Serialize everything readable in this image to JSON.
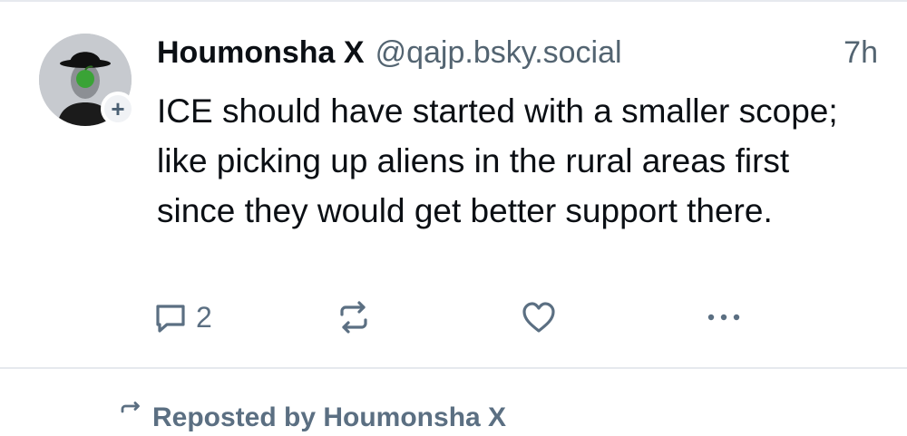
{
  "post": {
    "author": {
      "display_name": "Houmonsha X",
      "handle": "@qajp.bsky.social",
      "avatar_icon": "bowler-hat-man-with-apple-avatar",
      "follow_icon": "plus-icon",
      "follow_label": "+"
    },
    "time": "7h",
    "text": "ICE should have started with a smaller scope; like picking up aliens in the rural areas first since they would get better support there.",
    "actions": {
      "reply_icon": "reply-bubble-icon",
      "reply_count": "2",
      "repost_icon": "repost-icon",
      "like_icon": "heart-icon",
      "more_icon": "more-dots-icon"
    }
  },
  "next_item": {
    "repost_icon": "repost-icon",
    "reposted_by": "Reposted by Houmonsha X"
  },
  "colors": {
    "text": "#0b0f14",
    "muted": "#536471",
    "icon": "#5b6f82",
    "divider": "#e6e9ee"
  }
}
